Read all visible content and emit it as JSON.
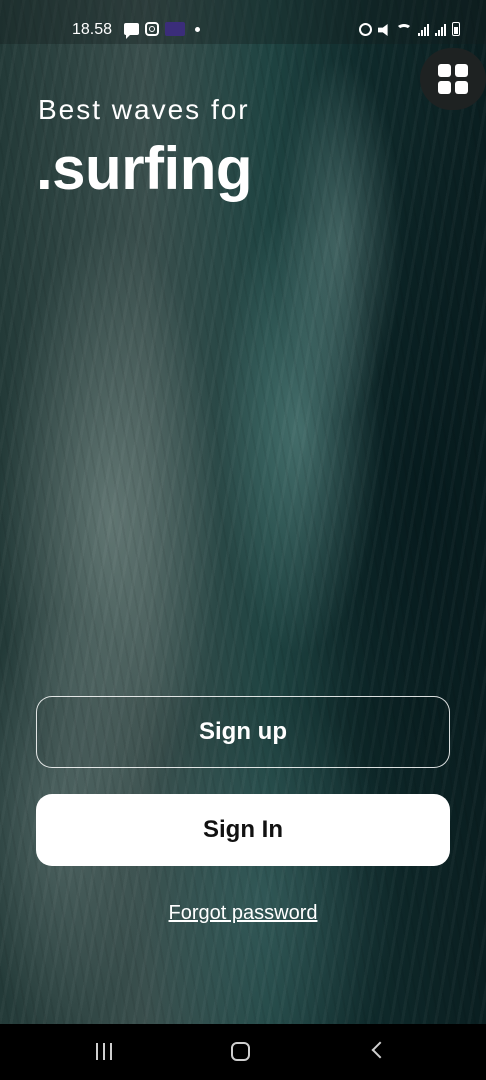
{
  "status_bar": {
    "time": "18.58",
    "left_icons": [
      "chat-icon",
      "instagram-icon",
      "app-icon",
      "dot-icon"
    ],
    "right_icons": [
      "alarm-icon",
      "mute-icon",
      "wifi-icon",
      "signal-icon",
      "signal-icon",
      "battery-icon"
    ]
  },
  "header": {
    "tagline": "Best waves for",
    "brand": ".surfing",
    "menu_icon": "grid-icon"
  },
  "actions": {
    "signup_label": "Sign up",
    "signin_label": "Sign In",
    "forgot_label": "Forgot password"
  },
  "nav_bar": {
    "icons": [
      "recent-apps-icon",
      "home-icon",
      "back-icon"
    ]
  }
}
